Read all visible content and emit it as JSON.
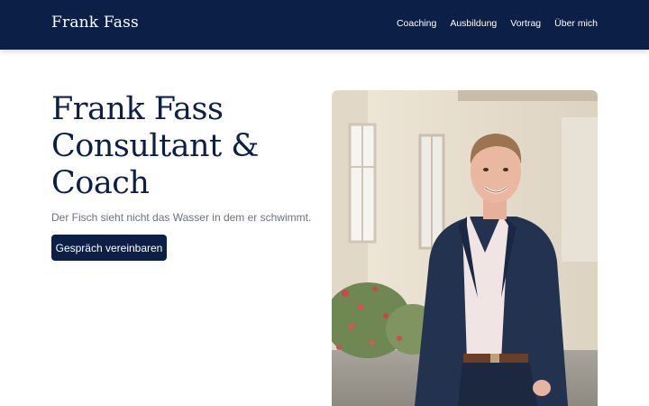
{
  "brand": {
    "name": "Frank Fass"
  },
  "nav": {
    "items": [
      {
        "label": "Coaching"
      },
      {
        "label": "Ausbildung"
      },
      {
        "label": "Vortrag"
      },
      {
        "label": "Über mich"
      }
    ]
  },
  "hero": {
    "title_lines": [
      "Frank Fass",
      "Consultant &",
      "Coach"
    ],
    "tagline": "Der Fisch sieht nicht das Wasser in dem er schwimmt.",
    "cta_label": "Gespräch vereinbaren"
  },
  "colors": {
    "navbar_bg": "#0c1f47",
    "title": "#0c1f47",
    "cta_bg": "#0c1f47",
    "tagline": "#6b7180"
  }
}
